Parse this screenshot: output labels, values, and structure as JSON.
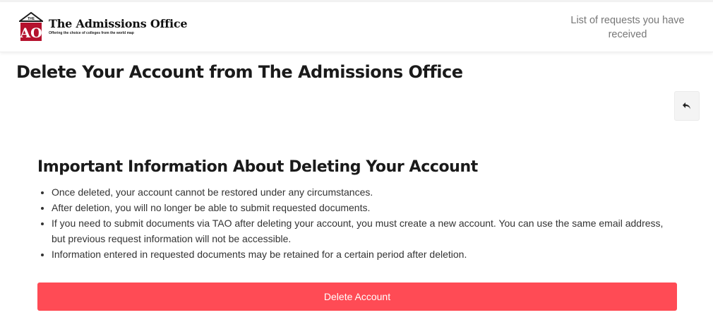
{
  "header": {
    "logo": {
      "mark_text_small": "THE",
      "mark_text_large": "AO",
      "title": "The Admissions Office",
      "tagline": "Offering the choice of colleges from the world map"
    },
    "requests_link": "List of requests you have received"
  },
  "page": {
    "title": "Delete Your Account from The Admissions Office"
  },
  "info": {
    "title": "Important Information About Deleting Your Account",
    "items": [
      "Once deleted, your account cannot be restored under any circumstances.",
      "After deletion, you will no longer be able to submit requested documents.",
      "If you need to submit documents via TAO after deleting your account, you must create a new account. You can use the same email address, but previous request information will not be accessible.",
      "Information entered in requested documents may be retained for a certain period after deletion."
    ]
  },
  "actions": {
    "delete_label": "Delete Account",
    "back_icon": "reply-arrow-icon"
  },
  "colors": {
    "danger": "#ff4b55",
    "logo_red": "#b5122e",
    "muted_text": "#777777"
  }
}
